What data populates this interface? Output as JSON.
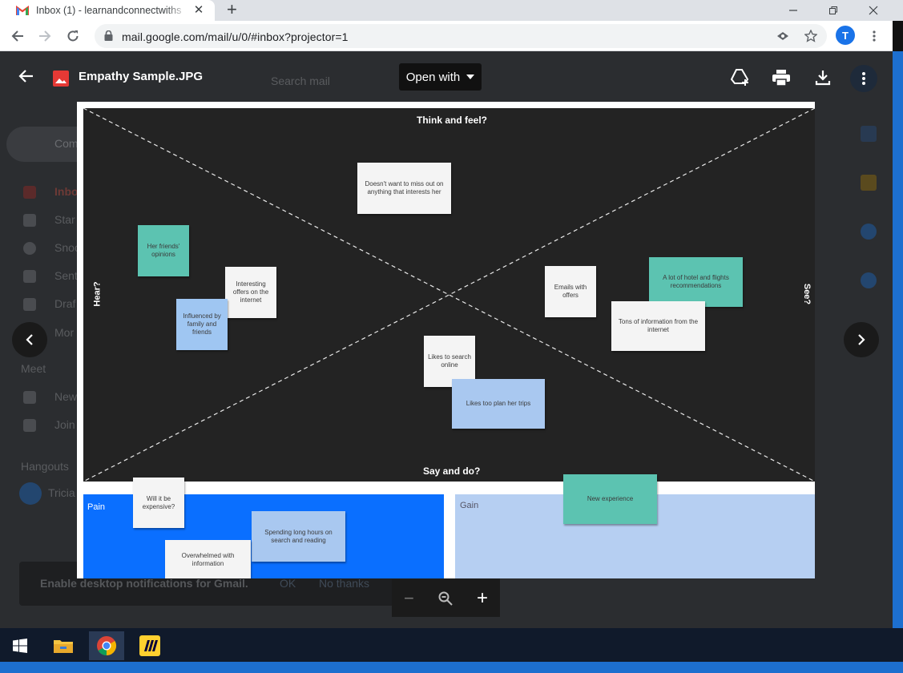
{
  "browser": {
    "tab_title": "Inbox (1) - learnandconnectwiths",
    "tab_close": "✕",
    "new_tab": "+",
    "url": "mail.google.com/mail/u/0/#inbox?projector=1",
    "profile_initial": "T"
  },
  "gmail_backdrop": {
    "search_placeholder": "Search mail",
    "compose_label": "Com",
    "nav": [
      "Inbox",
      "Star",
      "Snoo",
      "Sent",
      "Draf",
      "Mor"
    ],
    "meet_heading": "Meet",
    "meet_items": [
      "New",
      "Join"
    ],
    "hangouts_heading": "Hangouts",
    "hangouts_user": "Tricia",
    "notification": {
      "text": "Enable desktop notifications for Gmail.",
      "ok": "OK",
      "no_thanks": "No thanks"
    }
  },
  "viewer": {
    "file_name": "Empathy Sample.JPG",
    "open_with": "Open with",
    "zoom_out": "−",
    "zoom_in": "+"
  },
  "empathy_map": {
    "quadrants": {
      "top": "Think and feel?",
      "bottom": "Say and do?",
      "left": "Hear?",
      "right": "See?"
    },
    "stickies": {
      "think_1": "Doesn't want to miss out on anything that interests her",
      "hear_1": "Her friends' opinions",
      "hear_2": "Interesting offers on the internet",
      "hear_3": "Influenced by family and friends",
      "see_1": "Emails with offers",
      "see_2": "A lot of hotel and flights recommendations",
      "see_3": "Tons of information from the internet",
      "say_1": "Likes to search online",
      "say_2": "Likes too plan her trips"
    },
    "pain": {
      "label": "Pain",
      "stickies": [
        "Will it be expensive?",
        "Spending long hours on search and reading",
        "Overwhelmed with information"
      ]
    },
    "gain": {
      "label": "Gain",
      "stickies": [
        "New experience"
      ]
    }
  },
  "colors": {
    "board": "#232323",
    "pain": "#0a6fff",
    "gain": "#b6cff2",
    "sticky_teal": "#5cc3b1",
    "sticky_blue": "#9fc6f2"
  }
}
